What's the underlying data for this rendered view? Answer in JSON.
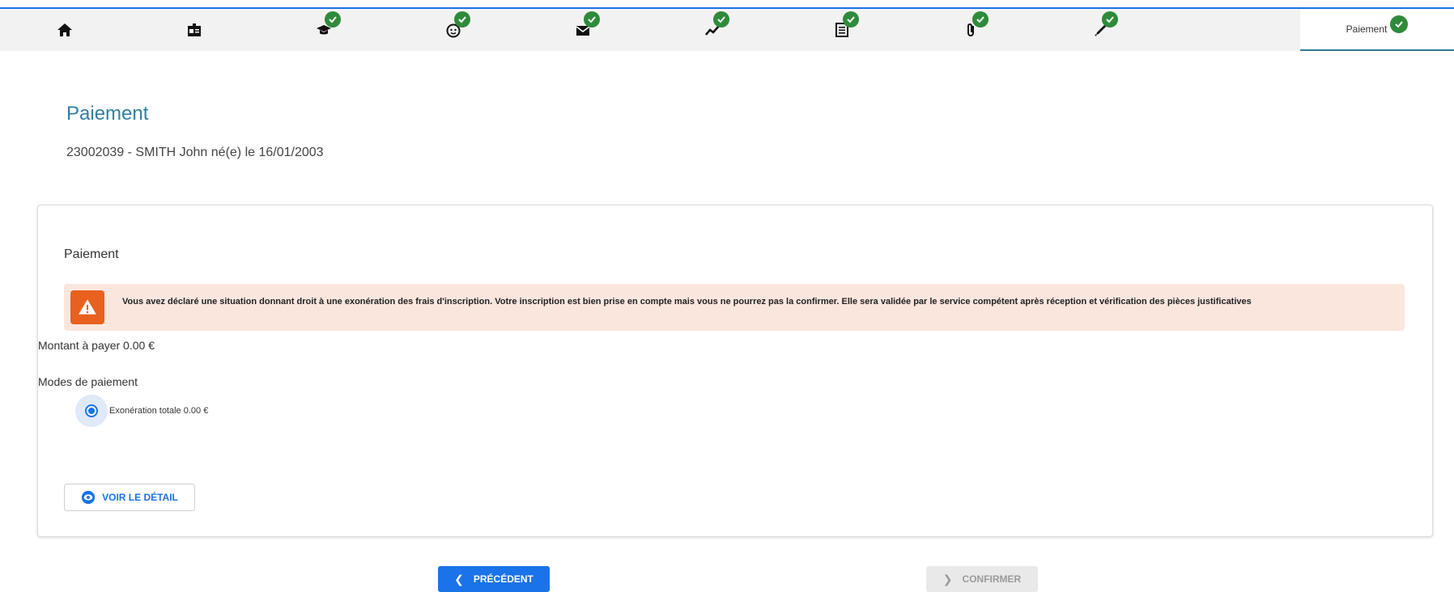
{
  "stepper": {
    "steps": [
      {
        "icon": "home-icon",
        "completed": false
      },
      {
        "icon": "id-card-icon",
        "completed": false
      },
      {
        "icon": "graduation-cap-icon",
        "completed": true
      },
      {
        "icon": "face-icon",
        "completed": true
      },
      {
        "icon": "envelope-icon",
        "completed": true
      },
      {
        "icon": "chart-line-icon",
        "completed": true
      },
      {
        "icon": "list-document-icon",
        "completed": true
      },
      {
        "icon": "paperclip-icon",
        "completed": true
      },
      {
        "icon": "pen-icon",
        "completed": true
      }
    ],
    "active_label": "Paiement",
    "accent_color": "#1a73e8",
    "check_color": "#2e8b3a"
  },
  "header": {
    "title": "Paiement",
    "subtitle": "23002039 - SMITH John né(e) le 16/01/2003"
  },
  "card": {
    "title": "Paiement",
    "alert_text": "Vous avez déclaré une situation donnant droit à une exonération des frais d'inscription. Votre inscription est bien prise en compte mais vous ne pourrez pas la confirmer. Elle sera validée par le service compétent après réception et vérification des pièces justificatives",
    "alert_icon": "warning-icon",
    "alert_color": "#e8611f",
    "amount_text": "Montant à payer 0.00 €",
    "modes_label": "Modes de paiement",
    "payment_option": "Exonération totale 0.00 €",
    "payment_option_selected": true,
    "detail_button": "VOIR LE DÉTAIL"
  },
  "nav": {
    "prev_label": "PRÉCÉDENT",
    "confirm_label": "CONFIRMER",
    "confirm_enabled": false
  }
}
